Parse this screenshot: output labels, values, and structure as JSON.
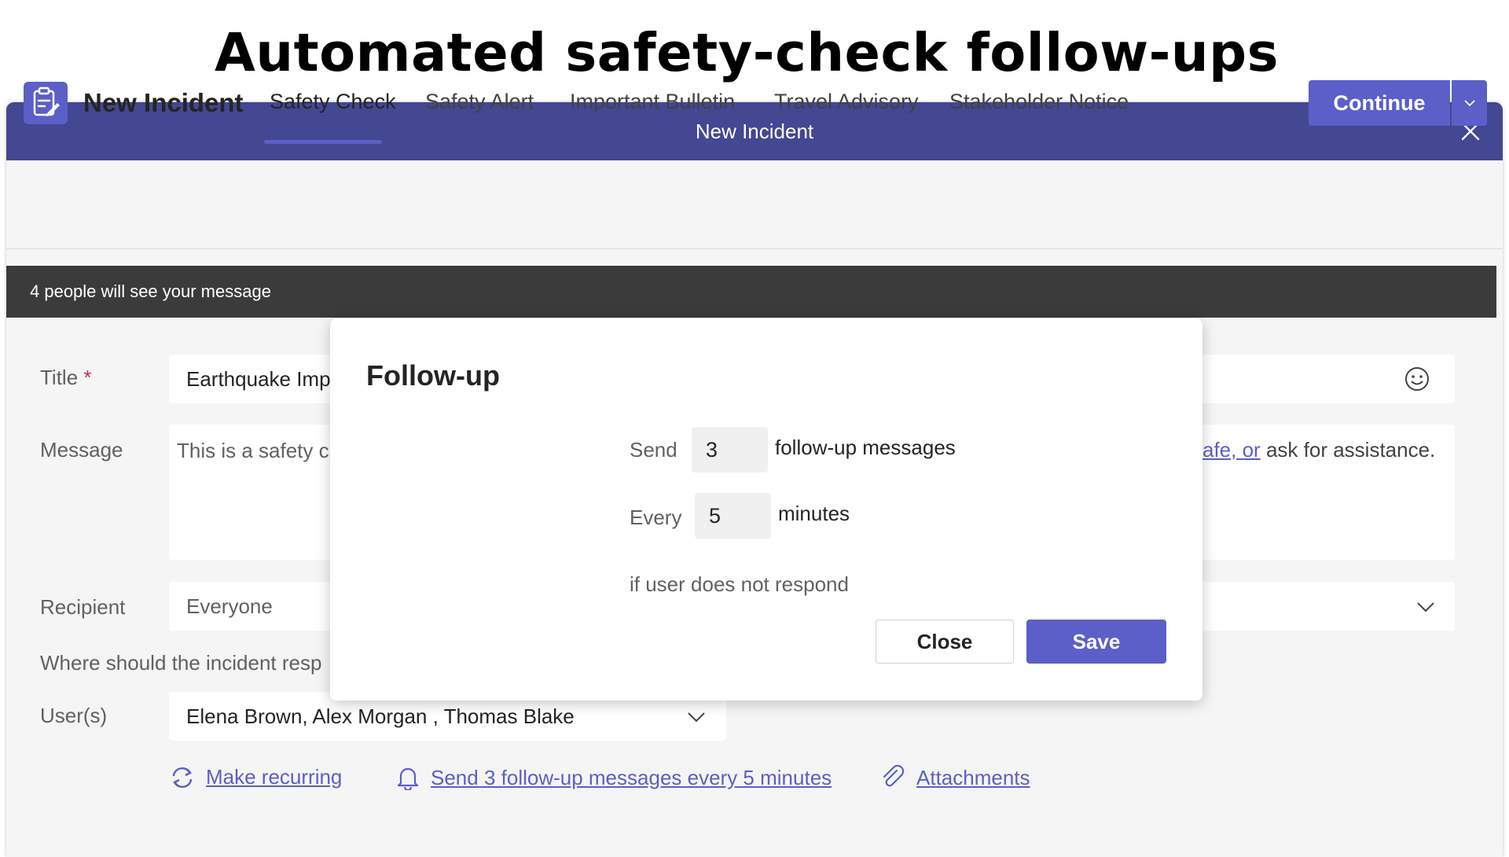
{
  "headline": "Automated safety-check follow-ups",
  "window": {
    "title": "New Incident"
  },
  "app": {
    "title": "New Incident",
    "tabs": [
      {
        "label": "Safety Check",
        "active": true
      },
      {
        "label": "Safety Alert"
      },
      {
        "label": "Important Bulletin"
      },
      {
        "label": "Travel Advisory"
      },
      {
        "label": "Stakeholder Notice"
      }
    ],
    "continue_label": "Continue"
  },
  "banner": {
    "text": "4 people will see your message"
  },
  "form": {
    "title_label": "Title",
    "required_mark": "*",
    "title_value": "Earthquake Imp",
    "message_label": "Message",
    "message_value": "This is a safety ch",
    "message_tail_link": "afe, or",
    "message_tail": "ask for assistance.",
    "recipient_label": "Recipient",
    "recipient_value": "Everyone",
    "helper": "Where should the incident resp",
    "users_label": "User(s)",
    "users_value": "Elena Brown, Alex Morgan , Thomas Blake",
    "links": {
      "recurring": "Make recurring",
      "followup": "Send 3 follow-up messages every 5 minutes",
      "attachments": "Attachments"
    }
  },
  "dialog": {
    "title": "Follow-up",
    "send_label": "Send",
    "send_value": "3",
    "send_suffix": "follow-up messages",
    "every_label": "Every",
    "every_value": "5",
    "every_suffix": "minutes",
    "note": "if user does not respond",
    "close_label": "Close",
    "save_label": "Save"
  },
  "colors": {
    "titlebar": "#444791",
    "accent": "#5b5fc7",
    "banner": "#3b3b3b"
  }
}
